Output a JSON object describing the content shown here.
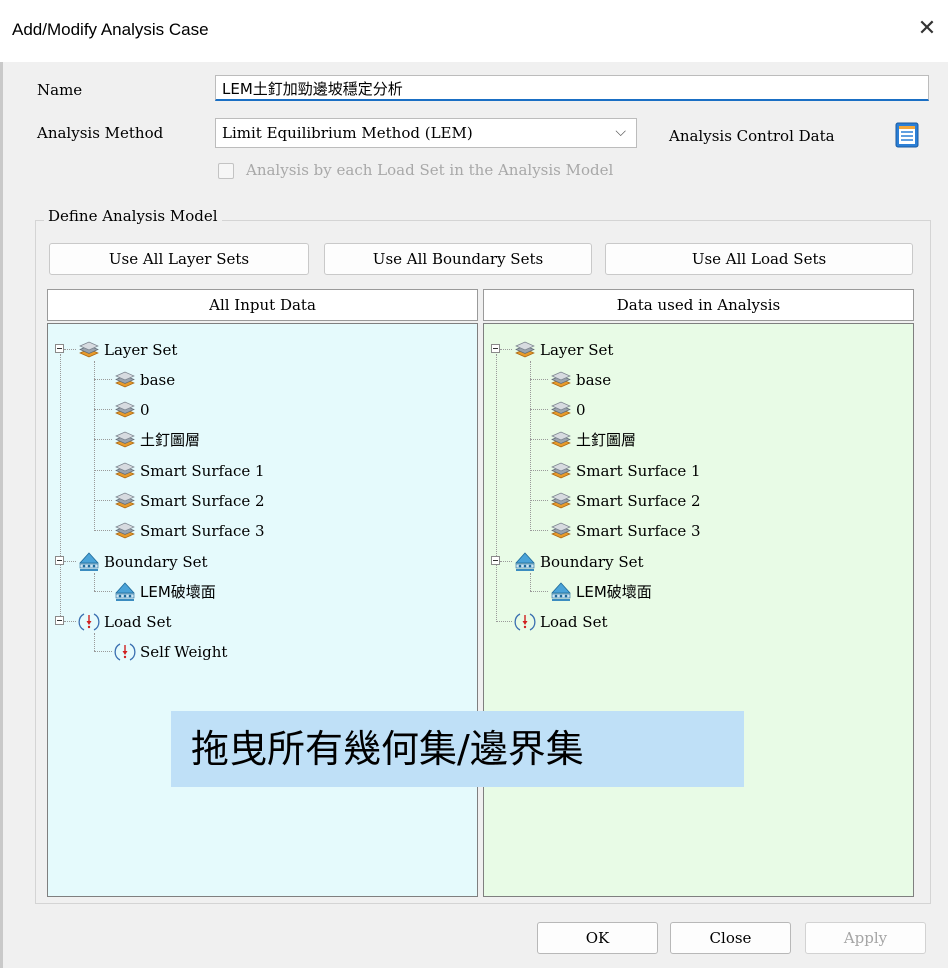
{
  "window": {
    "title": "Add/Modify Analysis Case"
  },
  "form": {
    "name_label": "Name",
    "name_value": "LEM土釘加勁邊坡穩定分析",
    "method_label": "Analysis Method",
    "method_value": "Limit Equilibrium Method (LEM)",
    "control_label": "Analysis Control Data",
    "checkbox_label": "Analysis by each Load Set in the Analysis Model"
  },
  "model": {
    "group_title": "Define Analysis Model",
    "btn_layer": "Use All Layer Sets",
    "btn_boundary": "Use All Boundary Sets",
    "btn_load": "Use All Load Sets",
    "col_left": "All Input Data",
    "col_right": "Data used in Analysis"
  },
  "left_tree": {
    "layer_set": "Layer Set",
    "layers": [
      "base",
      "0",
      "土釘圖層",
      "Smart Surface 1",
      "Smart Surface 2",
      "Smart Surface 3"
    ],
    "boundary_set": "Boundary Set",
    "boundaries": [
      "LEM破壞面"
    ],
    "load_set": "Load Set",
    "loads": [
      "Self Weight"
    ]
  },
  "right_tree": {
    "layer_set": "Layer Set",
    "layers": [
      "base",
      "0",
      "土釘圖層",
      "Smart Surface 1",
      "Smart Surface 2",
      "Smart Surface 3"
    ],
    "boundary_set": "Boundary Set",
    "boundaries": [
      "LEM破壞面"
    ],
    "load_set": "Load Set"
  },
  "annotation": "拖曳所有幾何集/邊界集",
  "footer": {
    "ok": "OK",
    "close": "Close",
    "apply": "Apply"
  },
  "colors": {
    "left_panel": "#e5fafc",
    "right_panel": "#e8fbe6",
    "accent": "#1a6fc4",
    "annotation_bg": "#bfe0f7"
  },
  "icons": {
    "layer": "layer-stack-icon",
    "boundary": "boundary-support-icon",
    "load": "load-arrow-icon",
    "control": "data-sheet-icon"
  }
}
